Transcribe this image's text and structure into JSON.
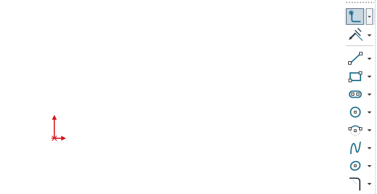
{
  "graphics_area": {
    "origin_icon": "sketch-origin-icon"
  },
  "sketch_toolbar": {
    "accent_color": "#1f6f8b",
    "tools": [
      {
        "id": "sketch",
        "icon": "sketch-icon",
        "active": true
      },
      {
        "id": "smart-dimension",
        "icon": "smart-dimension-icon",
        "active": false
      },
      {
        "id": "line",
        "icon": "line-icon",
        "active": false
      },
      {
        "id": "rectangle",
        "icon": "rectangle-icon",
        "active": false
      },
      {
        "id": "slot",
        "icon": "slot-icon",
        "active": false
      },
      {
        "id": "circle",
        "icon": "circle-icon",
        "active": false
      },
      {
        "id": "arc",
        "icon": "arc-icon",
        "active": false
      },
      {
        "id": "spline",
        "icon": "spline-icon",
        "active": false
      },
      {
        "id": "ellipse",
        "icon": "ellipse-icon",
        "active": false
      },
      {
        "id": "fillet",
        "icon": "sketch-fillet-icon",
        "active": false
      }
    ]
  }
}
